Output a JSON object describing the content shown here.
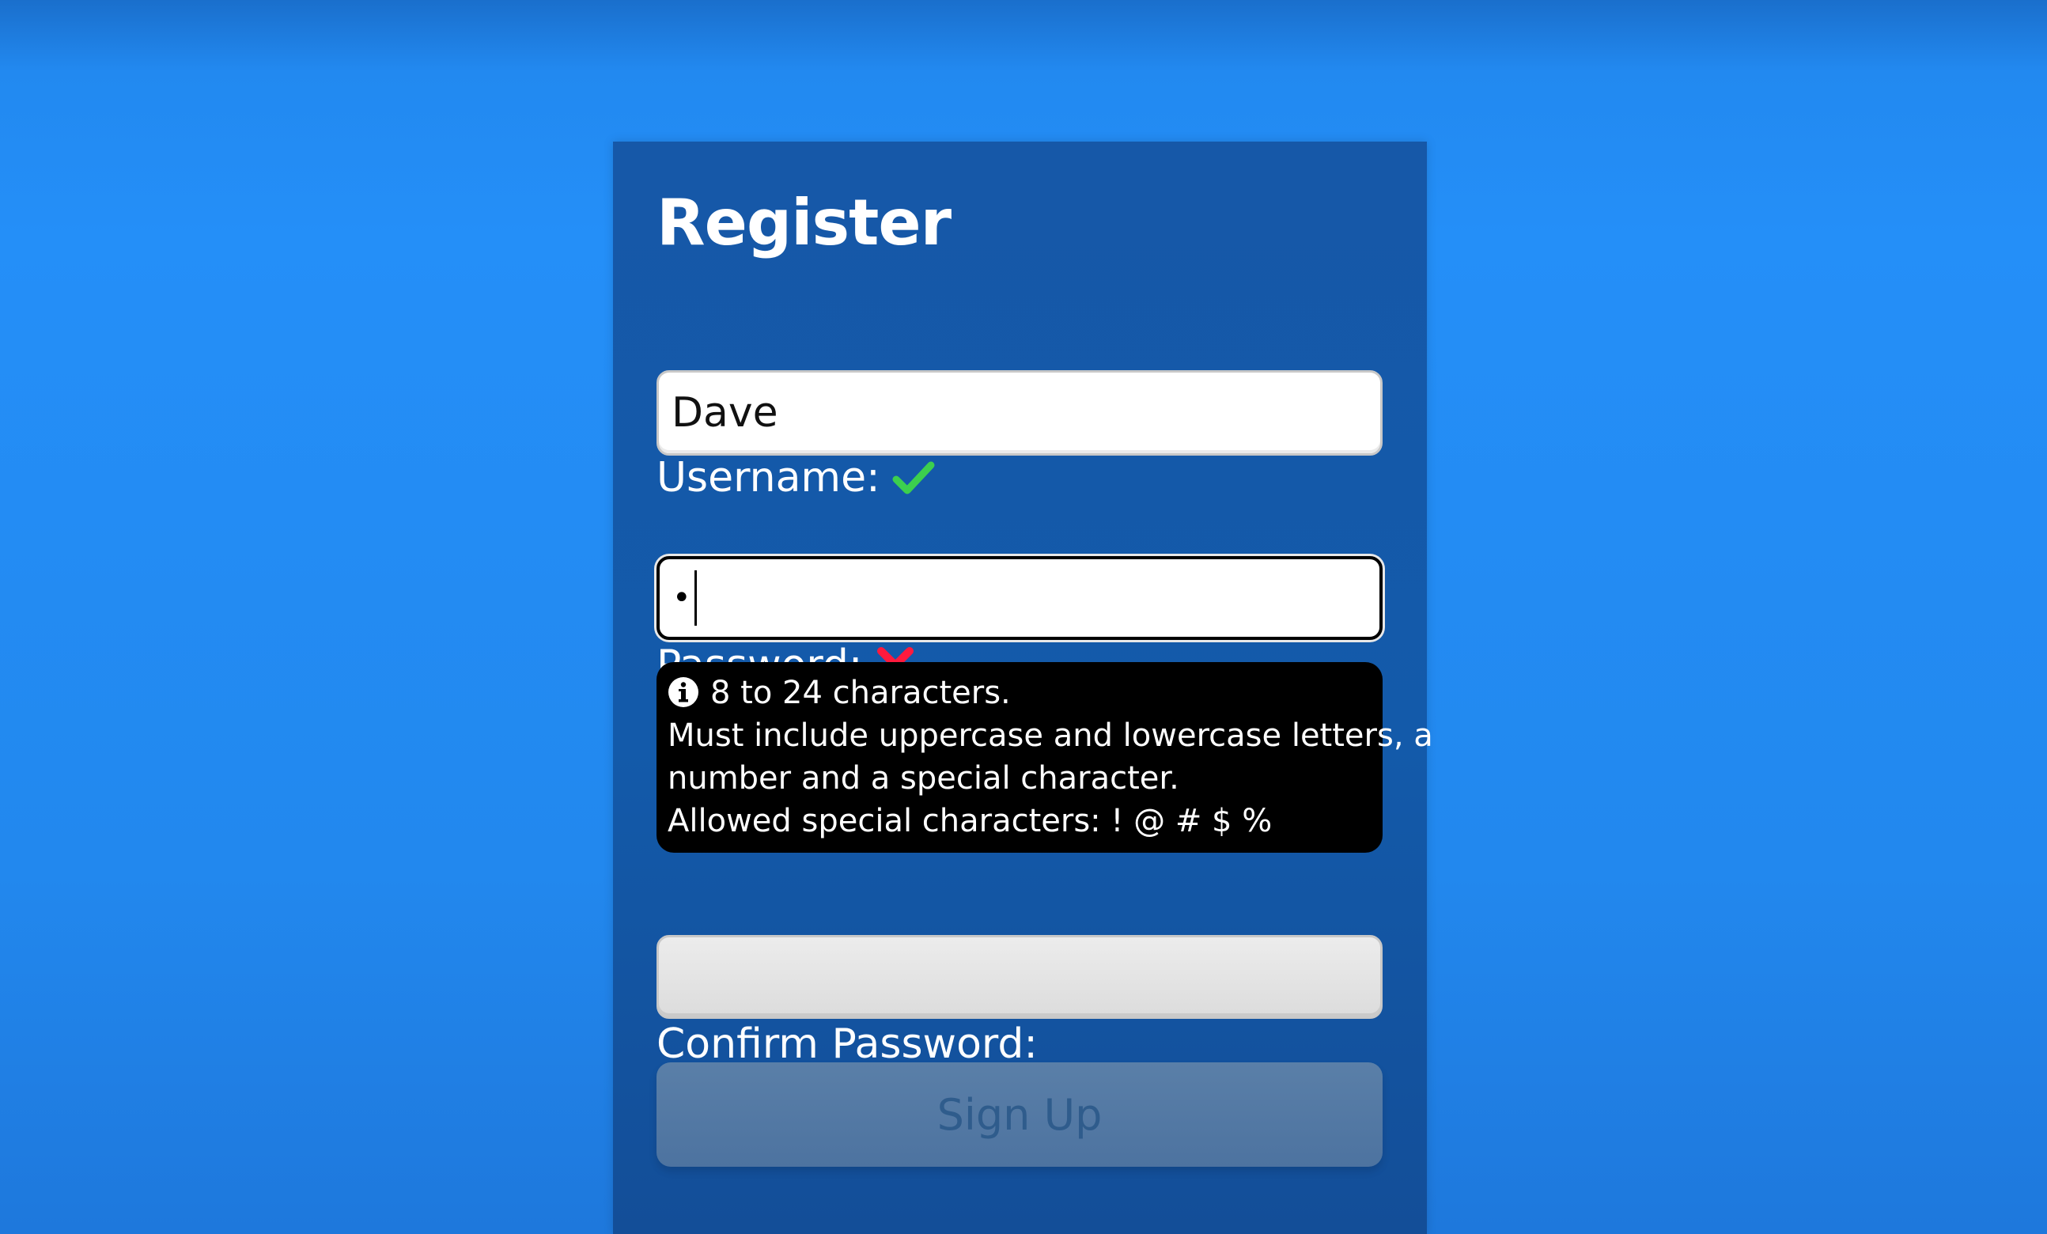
{
  "form": {
    "title": "Register",
    "username": {
      "label": "Username:",
      "value": "Dave",
      "status_icon": "check-icon",
      "status_color": "#3ccf4e"
    },
    "password": {
      "label": "Password:",
      "value": "•",
      "status_icon": "x-icon",
      "status_color": "#ff1a3d"
    },
    "password_note": {
      "icon": "info-icon",
      "lines": [
        "8 to 24 characters.",
        "Must include uppercase and lowercase letters, a",
        "number and a special character.",
        "Allowed special characters: ! @ # $ %"
      ]
    },
    "confirm_password": {
      "label": "Confirm Password:",
      "value": ""
    },
    "submit_label": "Sign Up"
  }
}
